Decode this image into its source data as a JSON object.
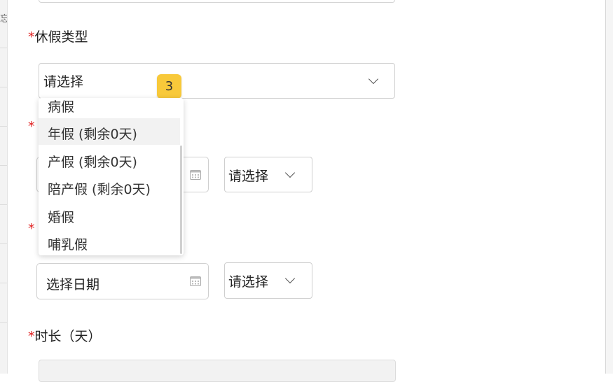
{
  "form": {
    "leave_type": {
      "required_mark": "*",
      "label": "休假类型",
      "placeholder": "请选择"
    },
    "badge": "3",
    "leave_type_options": [
      {
        "label": "病假"
      },
      {
        "label": "年假 (剩余0天)"
      },
      {
        "label": "产假 (剩余0天)"
      },
      {
        "label": "陪产假 (剩余0天)"
      },
      {
        "label": "婚假"
      },
      {
        "label": "哺乳假"
      }
    ],
    "start_row": {
      "required_mark": "*",
      "period_placeholder": "请选择"
    },
    "end_row": {
      "required_mark": "*",
      "date_placeholder": "选择日期",
      "period_placeholder": "请选择"
    },
    "duration": {
      "required_mark": "*",
      "label": "时长（天）"
    }
  },
  "icons": {
    "chevron": "chevron-down-icon",
    "calendar": "calendar-icon"
  },
  "colors": {
    "required": "#e02020",
    "badge": "#f8c93a",
    "border": "#cfcfcf"
  }
}
